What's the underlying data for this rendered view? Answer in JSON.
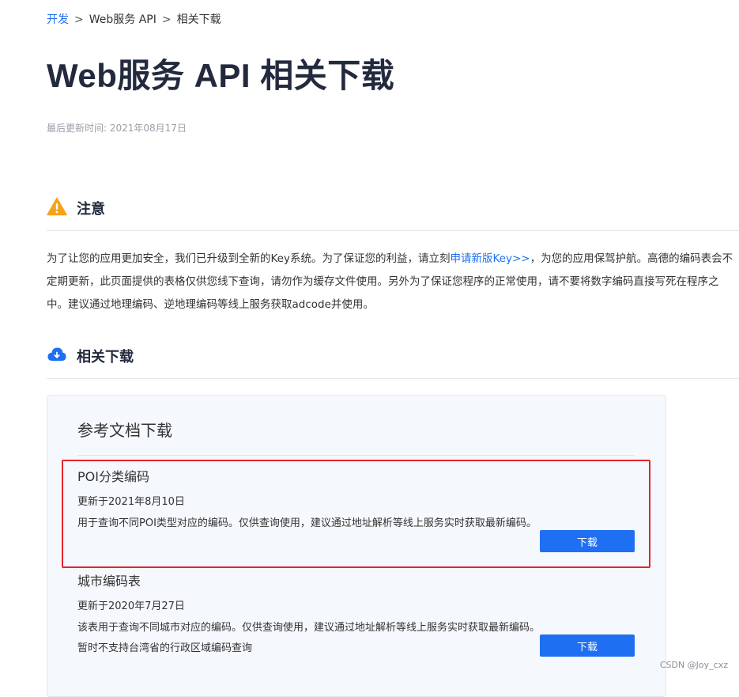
{
  "breadcrumb": {
    "items": [
      "开发",
      "Web服务 API",
      "相关下载"
    ],
    "separator": ">"
  },
  "page": {
    "title": "Web服务 API 相关下载",
    "last_updated": "最后更新时间: 2021年08月17日"
  },
  "notice": {
    "icon": "warning-icon",
    "heading": "注意",
    "lines": [
      {
        "before": "为了让您的应用更加安全，我们已升级到全新的Key系统。为了保证您的利益，请立刻",
        "link": "申请新版Key>>",
        "after": "，为您的应用保驾护航。高德的编码表会不"
      },
      "定期更新，此页面提供的表格仅供您线下查询，请勿作为缓存文件使用。另外为了保证您程序的正常使用，请不要将数字编码直接写死在程序之",
      "中。建议通过地理编码、逆地理编码等线上服务获取adcode并使用。"
    ]
  },
  "downloads": {
    "icon": "cloud-download-icon",
    "heading": "相关下载",
    "card_title": "参考文档下载",
    "items": [
      {
        "name": "POI分类编码",
        "updated": "更新于2021年8月10日",
        "description": "用于查询不同POI类型对应的编码。仅供查询使用，建议通过地址解析等线上服务实时获取最新编码。",
        "button": "下载"
      },
      {
        "name": "城市编码表",
        "updated": "更新于2020年7月27日",
        "description": "该表用于查询不同城市对应的编码。仅供查询使用，建议通过地址解析等线上服务实时获取最新编码。暂时不支持台湾省的行政区域编码查询",
        "button": "下载"
      }
    ]
  },
  "watermark": "CSDN @Joy_cxz",
  "colors": {
    "accent": "#1f6ff2",
    "title": "#242a3e",
    "warning": "#f5a31a",
    "highlight": "#e5242b"
  }
}
